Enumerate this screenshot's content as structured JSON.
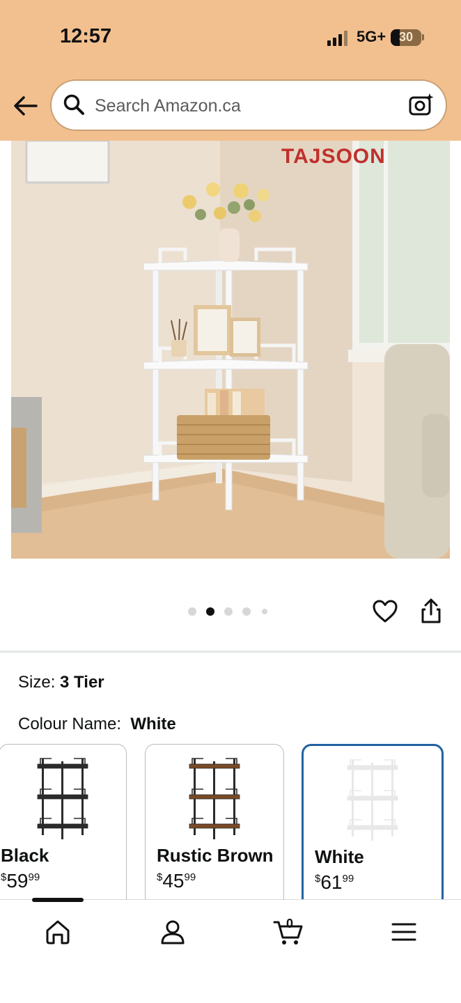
{
  "status_bar": {
    "time": "12:57",
    "network": "5G+",
    "battery_level": "30",
    "battery_fraction": 0.3
  },
  "search": {
    "placeholder": "Search Amazon.ca"
  },
  "product_image": {
    "brand_logo_text": "TAJSOON",
    "carousel_total": 5,
    "carousel_active_index": 1
  },
  "size": {
    "label": "Size:",
    "value": "3 Tier"
  },
  "colour": {
    "label": "Colour Name:",
    "value": "White"
  },
  "swatches": [
    {
      "name": "Black",
      "currency": "$",
      "dollars": "59",
      "cents": "99",
      "frame_color": "#2b2b2b",
      "shelf_color": "#2b2b2b",
      "selected": false
    },
    {
      "name": "Rustic Brown",
      "currency": "$",
      "dollars": "45",
      "cents": "99",
      "frame_color": "#2b2b2b",
      "shelf_color": "#7a4a26",
      "selected": false
    },
    {
      "name": "White",
      "currency": "$",
      "dollars": "61",
      "cents": "99",
      "frame_color": "#e8e8e8",
      "shelf_color": "#e8e8e8",
      "selected": true
    }
  ],
  "bottom_nav": {
    "cart_count": "0",
    "items": [
      "home-icon",
      "account-icon",
      "cart-icon",
      "menu-icon"
    ]
  },
  "colors": {
    "header_bg": "#f2c08f",
    "selected_border": "#2162a1",
    "brand_red": "#c0302c"
  }
}
